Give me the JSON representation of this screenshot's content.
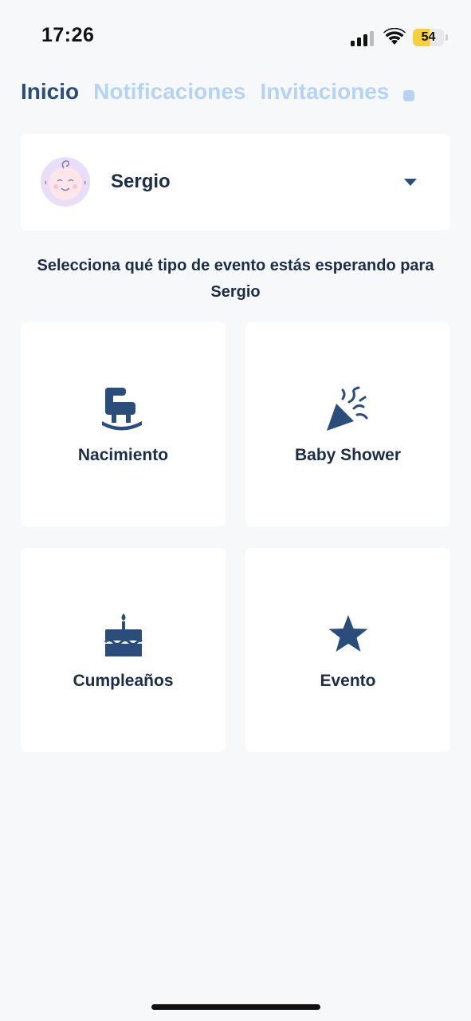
{
  "status_bar": {
    "time": "17:26",
    "battery_level": "54",
    "battery_fraction": 0.54
  },
  "tabs": [
    {
      "label": "Inicio",
      "active": true
    },
    {
      "label": "Notificaciones",
      "active": false
    },
    {
      "label": "Invitaciones",
      "active": false
    }
  ],
  "profile": {
    "name": "Sergio"
  },
  "prompt": "Selecciona qué tipo de evento estás esperando para Sergio",
  "event_types": [
    {
      "label": "Nacimiento",
      "icon": "rocking-cradle-icon"
    },
    {
      "label": "Baby Shower",
      "icon": "party-popper-icon"
    },
    {
      "label": "Cumpleaños",
      "icon": "birthday-cake-icon"
    },
    {
      "label": "Evento",
      "icon": "star-icon"
    }
  ],
  "colors": {
    "primary": "#2a4d7c",
    "tab_inactive": "#b5d3f5",
    "background": "#f7f8fa",
    "card": "#ffffff",
    "battery": "#f6cf3d"
  }
}
